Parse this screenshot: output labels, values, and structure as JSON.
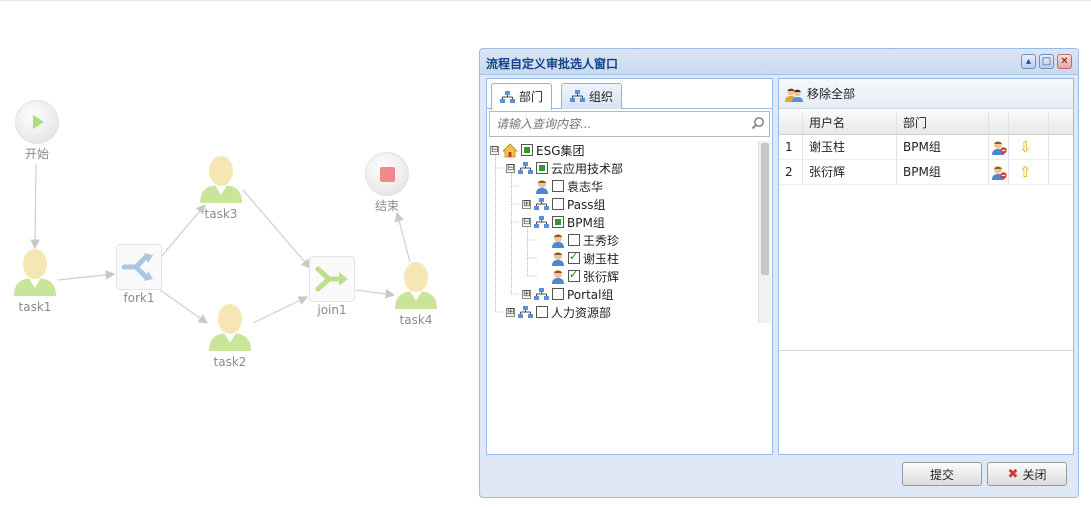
{
  "workflow": {
    "start_label": "开始",
    "end_label": "结束",
    "task1_label": "task1",
    "task2_label": "task2",
    "task3_label": "task3",
    "task4_label": "task4",
    "fork_label": "fork1",
    "join_label": "join1"
  },
  "dialog": {
    "title": "流程自定义审批选人窗口",
    "tabs": [
      {
        "label": "部门",
        "icon": "org-tree-icon",
        "active": true
      },
      {
        "label": "组织",
        "icon": "org-tree-icon",
        "active": false
      }
    ],
    "search_placeholder": "请输入查询内容...",
    "tree": [
      {
        "label": "ESG集团",
        "icon": "home-icon",
        "check": "partial",
        "toggle": "⊟"
      },
      {
        "label": "云应用技术部",
        "icon": "org-tree-icon",
        "check": "partial",
        "toggle": "⊟"
      },
      {
        "label": "袁志华",
        "icon": "user-icon",
        "check": "none"
      },
      {
        "label": "Pass组",
        "icon": "org-tree-icon",
        "check": "none",
        "toggle": "⊞"
      },
      {
        "label": "BPM组",
        "icon": "org-tree-icon",
        "check": "partial",
        "toggle": "⊟"
      },
      {
        "label": "王秀珍",
        "icon": "user-icon",
        "check": "none"
      },
      {
        "label": "谢玉柱",
        "icon": "user-icon",
        "check": "checked"
      },
      {
        "label": "张衍辉",
        "icon": "user-icon",
        "check": "checked"
      },
      {
        "label": "Portal组",
        "icon": "org-tree-icon",
        "check": "none",
        "toggle": "⊞"
      },
      {
        "label": "人力资源部",
        "icon": "org-tree-icon",
        "check": "none",
        "toggle": "⊞"
      }
    ],
    "remove_all_label": "移除全部",
    "grid": {
      "headers": [
        "用户名",
        "部门"
      ],
      "rows": [
        {
          "num": "1",
          "user": "谢玉柱",
          "dept": "BPM组",
          "action_icon": "user-remove-icon",
          "move_icon": "arrow-down-icon",
          "move_glyph": "⇩"
        },
        {
          "num": "2",
          "user": "张衍辉",
          "dept": "BPM组",
          "action_icon": "user-remove-icon",
          "move_icon": "arrow-up-icon",
          "move_glyph": "⇧"
        }
      ]
    },
    "submit_label": "提交",
    "close_label": "关闭"
  },
  "colors": {
    "dialog_border": "#99bbe8",
    "title_text": "#15428b",
    "start_green": "#a8e07a",
    "end_red": "#f08a8a",
    "check_green": "#2e9a2e",
    "arrow_yellow": "#f2c200",
    "close_red": "#d9362f"
  }
}
